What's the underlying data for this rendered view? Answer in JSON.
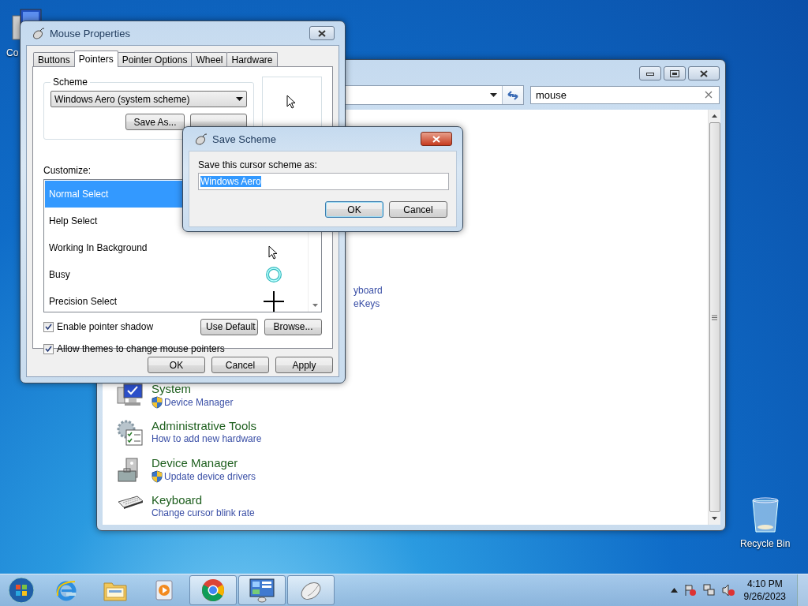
{
  "desktop": {
    "icons": [
      {
        "label": "Co",
        "kind": "computer"
      },
      {
        "label": "Recycle Bin",
        "kind": "recycle-bin"
      }
    ]
  },
  "control_panel": {
    "search": {
      "value": "mouse"
    },
    "partial_links": [
      "yboard",
      "eKeys"
    ],
    "items": [
      {
        "title": "System",
        "link": "Device Manager",
        "shield": true,
        "kind": "system"
      },
      {
        "title": "Administrative Tools",
        "link": "How to add new hardware",
        "shield": false,
        "kind": "admin"
      },
      {
        "title": "Device Manager",
        "link": "Update device drivers",
        "shield": true,
        "kind": "device"
      },
      {
        "title": "Keyboard",
        "link": "Change cursor blink rate",
        "shield": false,
        "kind": "keyboard"
      }
    ]
  },
  "mouse_properties": {
    "title": "Mouse Properties",
    "tabs": [
      {
        "label": "Buttons",
        "selected": false
      },
      {
        "label": "Pointers",
        "selected": true
      },
      {
        "label": "Pointer Options",
        "selected": false
      },
      {
        "label": "Wheel",
        "selected": false
      },
      {
        "label": "Hardware",
        "selected": false
      }
    ],
    "scheme_label": "Scheme",
    "scheme": "Windows Aero (system scheme)",
    "save_as": "Save As...",
    "customize_label": "Customize:",
    "pointers": [
      {
        "name": "Normal Select",
        "selected": true,
        "kind": "hidden"
      },
      {
        "name": "Help Select",
        "selected": false,
        "kind": "hidden"
      },
      {
        "name": "Working In Background",
        "selected": false,
        "kind": "arrow"
      },
      {
        "name": "Busy",
        "selected": false,
        "kind": "busy"
      },
      {
        "name": "Precision Select",
        "selected": false,
        "kind": "cross"
      }
    ],
    "checkboxes": [
      {
        "label": "Enable pointer shadow",
        "checked": true
      },
      {
        "label": "Allow themes to change mouse pointers",
        "checked": true
      }
    ],
    "use_default": "Use Default",
    "browse": "Browse...",
    "buttons": [
      "OK",
      "Cancel",
      "Apply"
    ]
  },
  "save_scheme": {
    "title": "Save Scheme",
    "prompt": "Save this cursor scheme as:",
    "value": "Windows Aero",
    "value_selected": true,
    "buttons": [
      {
        "label": "OK",
        "default": true
      },
      {
        "label": "Cancel",
        "default": false
      }
    ]
  },
  "taskbar": {
    "apps": [
      {
        "kind": "ie",
        "active": false
      },
      {
        "kind": "explorer",
        "active": false
      },
      {
        "kind": "media",
        "active": false
      },
      {
        "kind": "chrome",
        "active": true
      },
      {
        "kind": "control-panel",
        "active": true
      },
      {
        "kind": "mouse",
        "active": true
      }
    ],
    "clock": {
      "time": "4:10 PM",
      "date": "9/26/2023"
    }
  }
}
